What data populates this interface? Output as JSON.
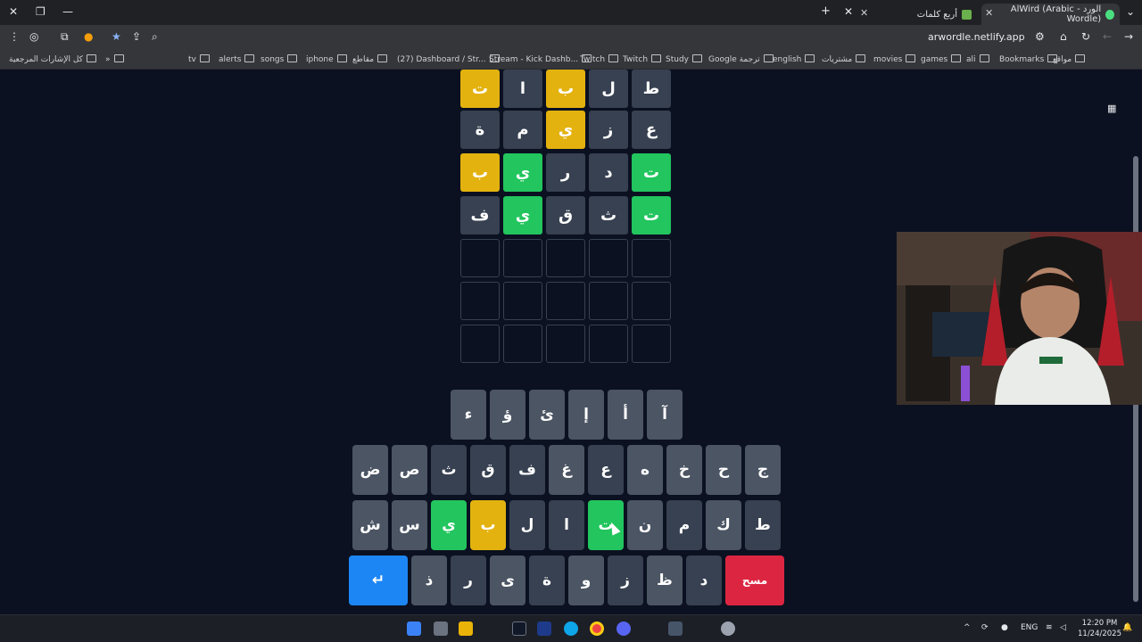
{
  "browser": {
    "active_tab_title": "الورد - AlWird (Arabic Wordle)",
    "second_tab_title": "أربع كلمات",
    "url": "arwordle.netlify.app",
    "bookmarks_all": "كل الإشارات المرجعية",
    "bookmarks": [
      {
        "label": "مواقع"
      },
      {
        "label": "Bookmarks"
      },
      {
        "label": "ali"
      },
      {
        "label": "games"
      },
      {
        "label": "movies"
      },
      {
        "label": "مشتريات"
      },
      {
        "label": "english"
      },
      {
        "label": "Google ترجمة"
      },
      {
        "label": "Study"
      },
      {
        "label": "Twitch"
      },
      {
        "label": "Twitch"
      },
      {
        "label": "Stream - Kick Dashb..."
      },
      {
        "label": "(27) Dashboard / Str..."
      },
      {
        "label": "مقاطع"
      },
      {
        "label": "iphone"
      },
      {
        "label": "songs"
      },
      {
        "label": "alerts"
      },
      {
        "label": "tv"
      }
    ]
  },
  "board": {
    "rows": [
      {
        "letters": [
          "ط",
          "ل",
          "ب",
          "ا",
          "ت"
        ],
        "states": [
          "gray",
          "gray",
          "yellow",
          "gray",
          "yellow"
        ]
      },
      {
        "letters": [
          "ع",
          "ز",
          "ي",
          "م",
          "ة"
        ],
        "states": [
          "gray",
          "gray",
          "yellow",
          "gray",
          "gray"
        ]
      },
      {
        "letters": [
          "ت",
          "د",
          "ر",
          "ي",
          "ب"
        ],
        "states": [
          "green",
          "gray",
          "gray",
          "green",
          "yellow"
        ]
      },
      {
        "letters": [
          "ت",
          "ث",
          "ق",
          "ي",
          "ف"
        ],
        "states": [
          "green",
          "gray",
          "gray",
          "green",
          "gray"
        ]
      },
      {
        "letters": [
          "",
          "",
          "",
          "",
          ""
        ],
        "states": [
          "empty",
          "empty",
          "empty",
          "empty",
          "empty"
        ]
      },
      {
        "letters": [
          "",
          "",
          "",
          "",
          ""
        ],
        "states": [
          "empty",
          "empty",
          "empty",
          "empty",
          "empty"
        ]
      },
      {
        "letters": [
          "",
          "",
          "",
          "",
          ""
        ],
        "states": [
          "empty",
          "empty",
          "empty",
          "empty",
          "empty"
        ]
      }
    ]
  },
  "keyboard": {
    "row1": [
      {
        "label": "آ",
        "state": "normal"
      },
      {
        "label": "أ",
        "state": "normal"
      },
      {
        "label": "إ",
        "state": "normal"
      },
      {
        "label": "ئ",
        "state": "normal"
      },
      {
        "label": "ؤ",
        "state": "normal"
      },
      {
        "label": "ء",
        "state": "normal"
      }
    ],
    "row2": [
      {
        "label": "ج",
        "state": "normal"
      },
      {
        "label": "ح",
        "state": "normal"
      },
      {
        "label": "خ",
        "state": "normal"
      },
      {
        "label": "ه",
        "state": "normal"
      },
      {
        "label": "ع",
        "state": "dark"
      },
      {
        "label": "غ",
        "state": "normal"
      },
      {
        "label": "ف",
        "state": "dark"
      },
      {
        "label": "ق",
        "state": "dark"
      },
      {
        "label": "ث",
        "state": "dark"
      },
      {
        "label": "ص",
        "state": "normal"
      },
      {
        "label": "ض",
        "state": "normal"
      }
    ],
    "row3": [
      {
        "label": "ط",
        "state": "dark"
      },
      {
        "label": "ك",
        "state": "normal"
      },
      {
        "label": "م",
        "state": "dark"
      },
      {
        "label": "ن",
        "state": "normal"
      },
      {
        "label": "ت",
        "state": "green"
      },
      {
        "label": "ا",
        "state": "dark"
      },
      {
        "label": "ل",
        "state": "dark"
      },
      {
        "label": "ب",
        "state": "yellow"
      },
      {
        "label": "ي",
        "state": "green"
      },
      {
        "label": "س",
        "state": "normal"
      },
      {
        "label": "ش",
        "state": "normal"
      }
    ],
    "row4": [
      {
        "label": "مسح",
        "state": "delete"
      },
      {
        "label": "د",
        "state": "dark"
      },
      {
        "label": "ظ",
        "state": "normal"
      },
      {
        "label": "ز",
        "state": "dark"
      },
      {
        "label": "و",
        "state": "normal"
      },
      {
        "label": "ة",
        "state": "dark"
      },
      {
        "label": "ى",
        "state": "normal"
      },
      {
        "label": "ر",
        "state": "dark"
      },
      {
        "label": "ذ",
        "state": "normal"
      },
      {
        "label": "↵",
        "state": "enter"
      }
    ]
  },
  "taskbar": {
    "language": "ENG",
    "time": "12:20 PM",
    "date": "11/24/2025"
  },
  "colors": {
    "background": "#0b1120",
    "tile_gray": "#374151",
    "tile_yellow": "#e3b20f",
    "tile_green": "#22c55e",
    "enter": "#1d86f5",
    "delete": "#dc2641"
  }
}
